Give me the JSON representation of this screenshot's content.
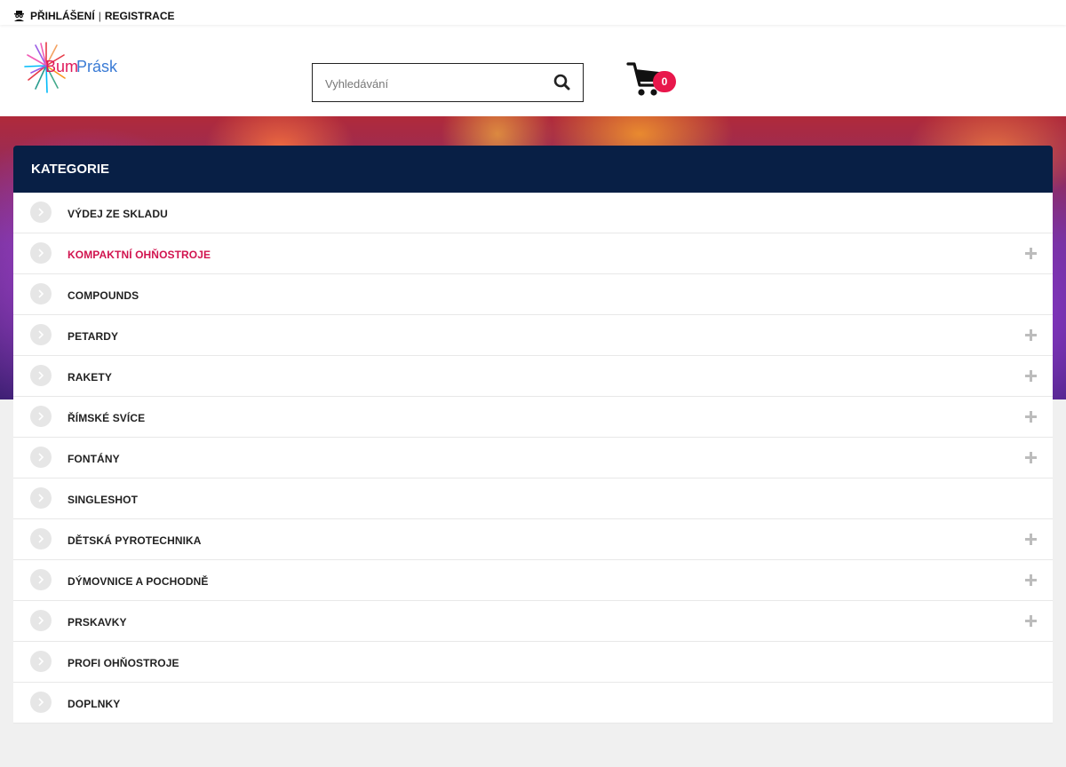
{
  "topbar": {
    "login_label": "PŘIHLÁŠENÍ",
    "separator": "|",
    "register_label": "REGISTRACE"
  },
  "logo": {
    "text_bum": "Bum",
    "text_prask": "Prásk"
  },
  "search": {
    "placeholder": "Vyhledávání",
    "value": ""
  },
  "cart": {
    "count": "0"
  },
  "categories": {
    "heading": "KATEGORIE",
    "items": [
      {
        "label": "VÝDEJ ZE SKLADU",
        "expandable": false,
        "active": false
      },
      {
        "label": "KOMPAKTNÍ OHŇOSTROJE",
        "expandable": true,
        "active": true
      },
      {
        "label": "COMPOUNDS",
        "expandable": false,
        "active": false
      },
      {
        "label": "PETARDY",
        "expandable": true,
        "active": false
      },
      {
        "label": "RAKETY",
        "expandable": true,
        "active": false
      },
      {
        "label": "ŘÍMSKÉ SVÍCE",
        "expandable": true,
        "active": false
      },
      {
        "label": "FONTÁNY",
        "expandable": true,
        "active": false
      },
      {
        "label": "SINGLESHOT",
        "expandable": false,
        "active": false
      },
      {
        "label": "DĚTSKÁ PYROTECHNIKA",
        "expandable": true,
        "active": false
      },
      {
        "label": "DÝMOVNICE A POCHODNĚ",
        "expandable": true,
        "active": false
      },
      {
        "label": "PRSKAVKY",
        "expandable": true,
        "active": false
      },
      {
        "label": "PROFI OHŇOSTROJE",
        "expandable": false,
        "active": false
      },
      {
        "label": "DOPLNKY",
        "expandable": false,
        "active": false
      }
    ]
  },
  "colors": {
    "accent": "#d1144f",
    "panel_header": "#081f45",
    "badge": "#e8174b"
  },
  "icons": {
    "user": "user-secret-icon",
    "search": "search-icon",
    "cart": "cart-icon",
    "chevron": "chevron-right-icon",
    "expand": "plus-icon"
  }
}
